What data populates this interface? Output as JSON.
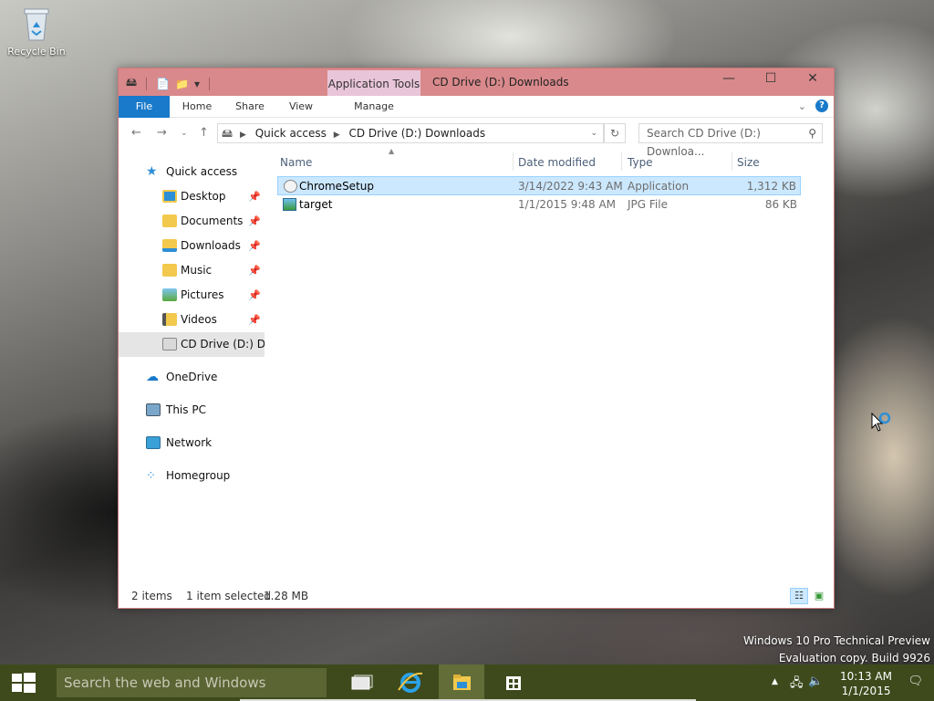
{
  "desktop": {
    "recycle_bin_label": "Recycle Bin"
  },
  "window": {
    "title": "CD Drive (D:) Downloads",
    "context_tab_label": "Application Tools",
    "controls": {
      "minimize": "—",
      "maximize": "☐",
      "close": "✕"
    }
  },
  "ribbon": {
    "tabs": [
      {
        "label": "File"
      },
      {
        "label": "Home"
      },
      {
        "label": "Share"
      },
      {
        "label": "View"
      },
      {
        "label": "Manage"
      }
    ],
    "help": "?"
  },
  "address": {
    "segments": [
      "Quick access",
      "CD Drive (D:) Downloads"
    ],
    "search_placeholder": "Search CD Drive (D:) Downloa..."
  },
  "nav_pane": {
    "quick_access": "Quick access",
    "items": [
      {
        "label": "Desktop",
        "icon": "desktop-icon"
      },
      {
        "label": "Documents",
        "icon": "documents-icon"
      },
      {
        "label": "Downloads",
        "icon": "downloads-icon"
      },
      {
        "label": "Music",
        "icon": "music-icon"
      },
      {
        "label": "Pictures",
        "icon": "pictures-icon"
      },
      {
        "label": "Videos",
        "icon": "videos-icon"
      }
    ],
    "cd_drive": "CD Drive (D:) Downloads",
    "onedrive": "OneDrive",
    "this_pc": "This PC",
    "network": "Network",
    "homegroup": "Homegroup"
  },
  "columns": {
    "name": "Name",
    "date_modified": "Date modified",
    "type": "Type",
    "size": "Size"
  },
  "files": [
    {
      "name": "ChromeSetup",
      "date": "3/14/2022 9:43 AM",
      "type": "Application",
      "size": "1,312 KB",
      "selected": true
    },
    {
      "name": "target",
      "date": "1/1/2015 9:48 AM",
      "type": "JPG File",
      "size": "86 KB",
      "selected": false
    }
  ],
  "status": {
    "items": "2 items",
    "selected": "1 item selected",
    "size": "1.28 MB"
  },
  "watermark": {
    "line1": "Windows 10 Pro Technical Preview",
    "line2": "Evaluation copy. Build 9926"
  },
  "taskbar": {
    "search_placeholder": "Search the web and Windows",
    "time": "10:13 AM",
    "date": "1/1/2015"
  },
  "colors": {
    "titlebar": "#d9898b",
    "accent": "#1979ca",
    "selection": "#cce8ff",
    "taskbar": "#3e4a1c"
  }
}
